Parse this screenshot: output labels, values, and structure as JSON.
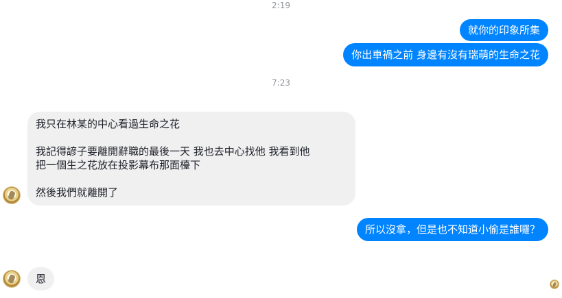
{
  "conversation": {
    "timestamps": [
      "2:19",
      "7:23"
    ],
    "outgoing_1": [
      "就你的印象所集",
      "你出車禍之前 身邊有沒有瑞萌的生命之花"
    ],
    "incoming_1": {
      "p1": "我只在林某的中心看過生命之花",
      "p2_line1": "我記得諺子要離開辭職的最後一天 我也去中心找他 我看到他",
      "p2_line2": "把一個生之花放在投影幕布那面檯下",
      "p3": "然後我們就離開了"
    },
    "outgoing_2": "所以沒拿，但是也不知道小偷是誰囉？",
    "incoming_2": "恩"
  }
}
